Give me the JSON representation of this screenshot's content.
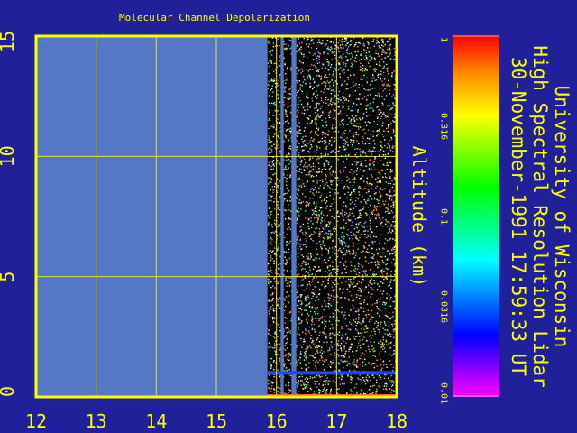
{
  "chart_data": {
    "type": "heatmap",
    "title": "Molecular Channel Depolarization",
    "xlabel": "",
    "ylabel": "Altitude (km)",
    "xlim": [
      12,
      18
    ],
    "ylim": [
      0,
      15
    ],
    "x_ticks": [
      12,
      13,
      14,
      15,
      16,
      17,
      18
    ],
    "y_ticks": [
      0,
      5,
      10,
      15
    ],
    "x_tick_labels": [
      "12",
      "13",
      "14",
      "15",
      "16",
      "17",
      "18"
    ],
    "y_tick_labels": [
      "0",
      "5",
      "10",
      "15"
    ],
    "grid": true,
    "data_start_x": 15.85,
    "gaps_x": [
      [
        16.07,
        16.12
      ],
      [
        16.25,
        16.33
      ]
    ],
    "ground_layer_altitude_km": 1.0,
    "colorbar": {
      "scale": "log",
      "range": [
        0.01,
        1
      ],
      "tick_labels": [
        "1",
        "0.316",
        "0.1",
        "0.0316",
        "0.01"
      ],
      "colormap": [
        "#ff00ff",
        "#0000ff",
        "#00ffff",
        "#00ff00",
        "#ffff00",
        "#ff8800",
        "#ff0000"
      ]
    }
  },
  "header": {
    "institution": "University of Wisconsin",
    "instrument": "High Spectral Resolution Lidar",
    "datetime": "30-November-1991 17:59:33 UT"
  },
  "colors": {
    "background": "#20209a",
    "plot_fill": "#5577c4",
    "axis": "#ffff00",
    "grid": "#e0e040"
  }
}
